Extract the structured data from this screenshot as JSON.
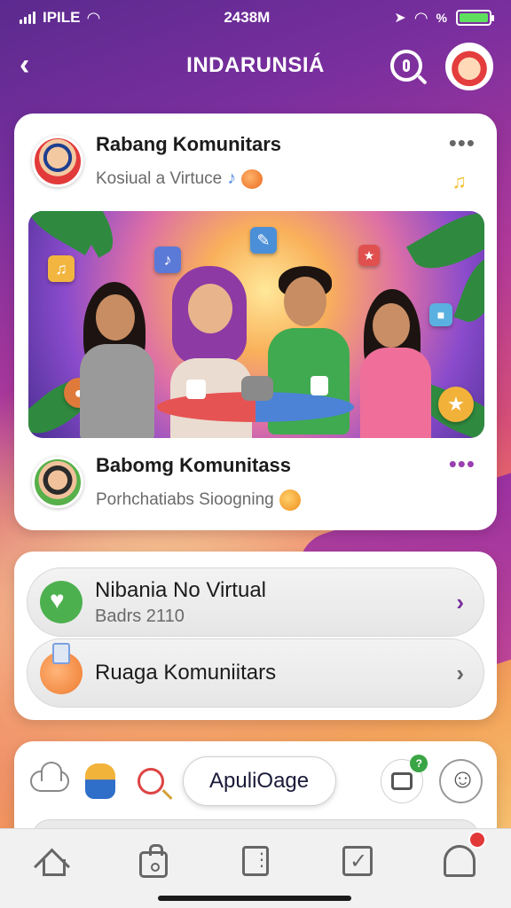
{
  "status_bar": {
    "carrier": "IPILE",
    "time": "2438M",
    "battery_percent_symbol": "%"
  },
  "header": {
    "title": "INDARUNSIÁ"
  },
  "feed": {
    "post_1": {
      "title": "Rabang Komunitars",
      "subtitle": "Kosiual a Virtuce"
    },
    "post_2": {
      "title": "Babomg Komunitass",
      "subtitle": "Porhchatiabs Sioogning"
    }
  },
  "list": {
    "item_1": {
      "title": "Nibania No Virtual",
      "subtitle": "Badrs 2110"
    },
    "item_2": {
      "title": "Ruaga Komuniitars"
    }
  },
  "toolbar": {
    "apply_label": "ApuliOage",
    "printer_badge": "?"
  },
  "colors": {
    "accent_purple": "#7a2f9e",
    "accent_green": "#4cb04f",
    "badge_red": "#e23838"
  },
  "icons": {
    "back": "chevron-left-icon",
    "search": "search-icon",
    "more": "more-dots-icon",
    "heart": "heart-icon",
    "chevron": "chevron-right-icon",
    "home": "home-icon",
    "bag": "bag-icon",
    "menu": "menu-icon",
    "check": "check-icon",
    "ghost": "ghost-icon"
  }
}
